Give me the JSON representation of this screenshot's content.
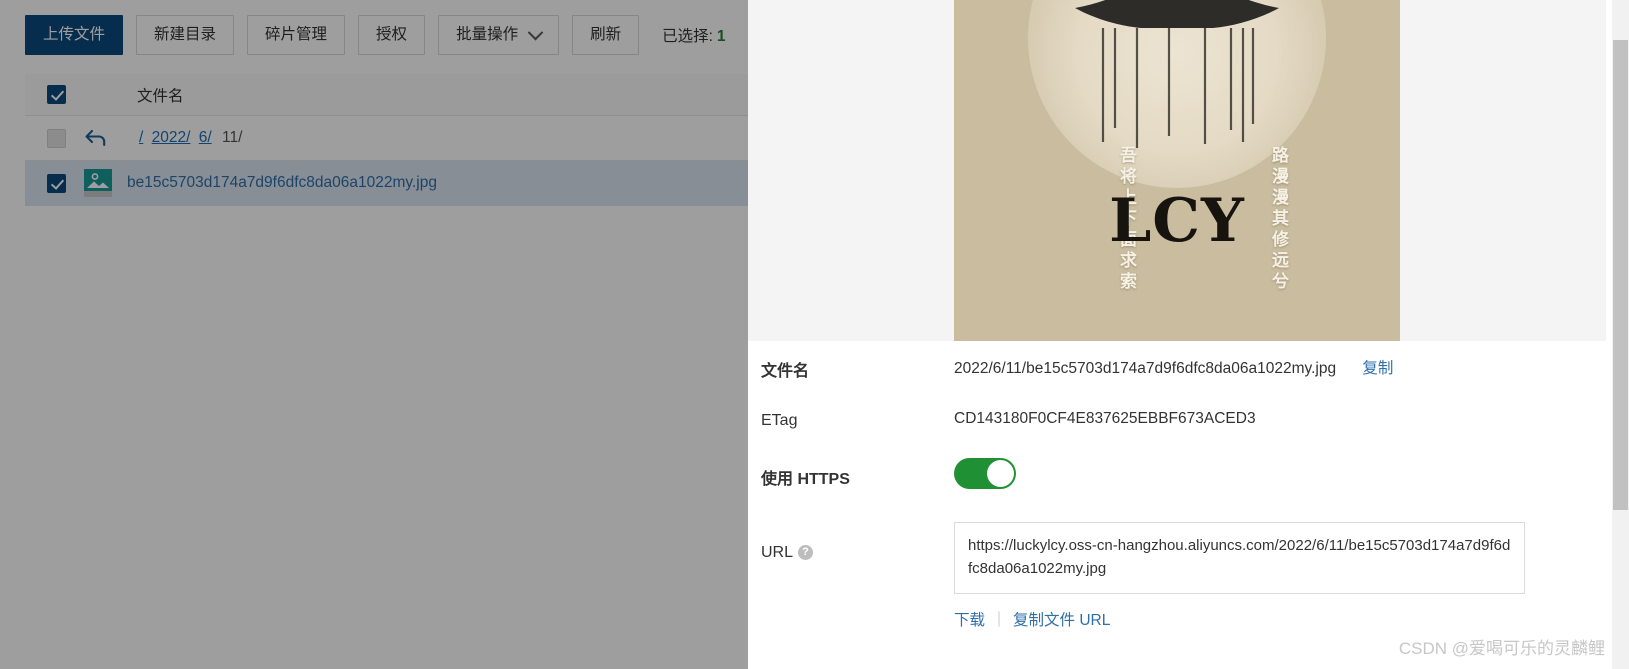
{
  "toolbar": {
    "buttons": [
      {
        "label": "上传文件",
        "name": "upload-file-button",
        "primary": true
      },
      {
        "label": "新建目录",
        "name": "new-folder-button",
        "primary": false
      },
      {
        "label": "碎片管理",
        "name": "fragment-manage-button",
        "primary": false
      },
      {
        "label": "授权",
        "name": "authorize-button",
        "primary": false
      },
      {
        "label": "批量操作",
        "name": "batch-operation-button",
        "primary": false,
        "dropdown": true
      },
      {
        "label": "刷新",
        "name": "refresh-button",
        "primary": false
      }
    ],
    "selection_label": "已选择:",
    "selection_count": "1"
  },
  "table": {
    "header": {
      "filename": "文件名"
    },
    "breadcrumb": {
      "root": "/",
      "year": "2022/",
      "month": "6/",
      "day": "11/"
    },
    "rows": [
      {
        "filename": "be15c5703d174a7d9f6dfc8da06a1022my.jpg",
        "icon": "image-file-icon",
        "checked": true
      }
    ]
  },
  "preview": {
    "image_alt": "LCY 宝塔插图",
    "brand": "LCY",
    "left_column": "吾将上下面求索",
    "right_column": "路漫漫其修远兮",
    "bg_color": "#c9bc9f"
  },
  "details": {
    "filename_label": "文件名",
    "filename_value": "2022/6/11/be15c5703d174a7d9f6dfc8da06a1022my.jpg",
    "filename_copy_label": "复制",
    "etag_label": "ETag",
    "etag_value": "CD143180F0CF4E837625EBBF673ACED3",
    "https_label": "使用 HTTPS",
    "https_enabled": "on",
    "url_label": "URL",
    "url_help": "?",
    "url_value": "https://luckylcy.oss-cn-hangzhou.aliyuncs.com/2022/6/11/be15c5703d174a7d9f6dfc8da06a1022my.jpg",
    "download_label": "下载",
    "copy_url_label": "复制文件 URL",
    "separator": "|"
  },
  "watermark": "CSDN @爱喝可乐的灵麟鲤",
  "colors": {
    "primary": "#0a4a7d",
    "link": "#2f6fa8",
    "toggle_on": "#1f9134",
    "selected_row": "#dbe6f0"
  }
}
